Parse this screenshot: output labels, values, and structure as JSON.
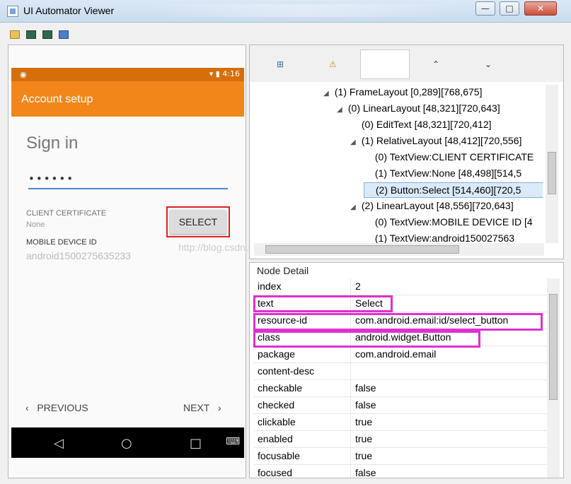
{
  "window": {
    "title": "UI Automator Viewer"
  },
  "device": {
    "status_time": "4:16",
    "appbar_title": "Account setup",
    "heading": "Sign in",
    "password_dots": "••••••",
    "client_cert_label": "CLIENT CERTIFICATE",
    "client_cert_value": "None",
    "select_label": "SELECT",
    "mobile_id_label": "MOBILE DEVICE ID",
    "mobile_id_value": "android1500275635233",
    "prev_label": "PREVIOUS",
    "next_label": "NEXT"
  },
  "watermark": "http://blog.csdn.net/qq_15150911",
  "tree": [
    {
      "text": "(1) FrameLayout [0,289][768,675]",
      "expanded": true,
      "selected": false
    },
    {
      "text": "(0) LinearLayout [48,321][720,643]",
      "expanded": true,
      "selected": false
    },
    {
      "text": "(0) EditText [48,321][720,412]",
      "expanded": false,
      "selected": false
    },
    {
      "text": "(1) RelativeLayout [48,412][720,556]",
      "expanded": true,
      "selected": false
    },
    {
      "text": "(0) TextView:CLIENT CERTIFICATE",
      "expanded": false,
      "selected": false
    },
    {
      "text": "(1) TextView:None [48,498][514,5",
      "expanded": false,
      "selected": false
    },
    {
      "text": "(2) Button:Select [514,460][720,5",
      "expanded": false,
      "selected": true
    },
    {
      "text": "(2) LinearLayout [48,556][720,643]",
      "expanded": true,
      "selected": false
    },
    {
      "text": "(0) TextView:MOBILE DEVICE ID [4",
      "expanded": false,
      "selected": false
    },
    {
      "text": "(1) TextView:android150027563",
      "expanded": false,
      "selected": false
    }
  ],
  "node_detail": {
    "title": "Node Detail",
    "rows": [
      {
        "key": "index",
        "value": "2"
      },
      {
        "key": "text",
        "value": "Select"
      },
      {
        "key": "resource-id",
        "value": "com.android.email:id/select_button"
      },
      {
        "key": "class",
        "value": "android.widget.Button"
      },
      {
        "key": "package",
        "value": "com.android.email"
      },
      {
        "key": "content-desc",
        "value": ""
      },
      {
        "key": "checkable",
        "value": "false"
      },
      {
        "key": "checked",
        "value": "false"
      },
      {
        "key": "clickable",
        "value": "true"
      },
      {
        "key": "enabled",
        "value": "true"
      },
      {
        "key": "focusable",
        "value": "true"
      },
      {
        "key": "focused",
        "value": "false"
      }
    ]
  }
}
